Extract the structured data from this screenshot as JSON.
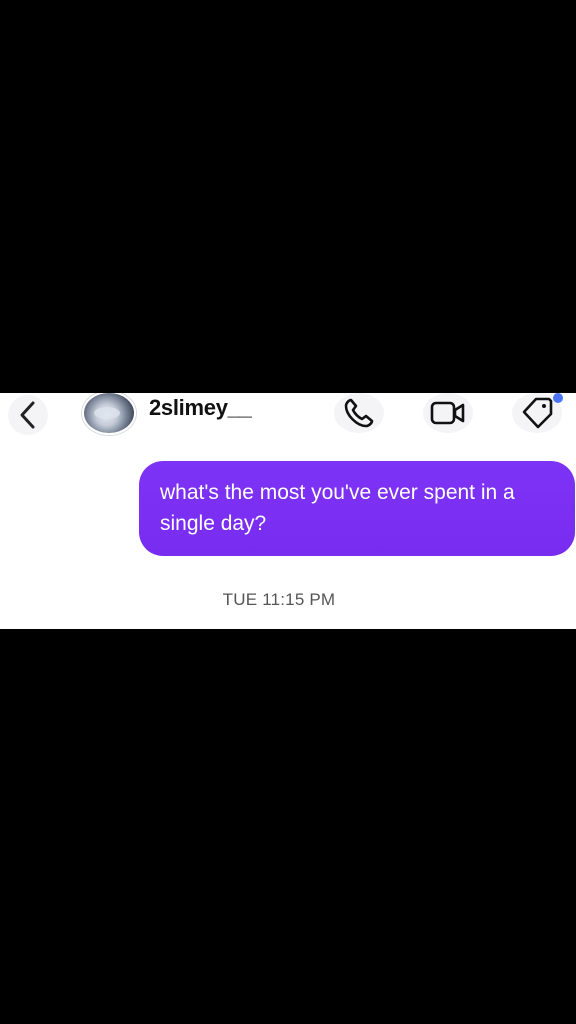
{
  "header": {
    "username": "2slimey__",
    "back_icon": "chevron-left-icon",
    "call_icon": "phone-icon",
    "video_icon": "video-camera-icon",
    "tag_icon": "tag-icon",
    "notification_dot_color": "#4a74f5"
  },
  "thread": {
    "messages": [
      {
        "direction": "outgoing",
        "text": "what's the most you've ever spent in a single day?",
        "bubble_color": "#7b2ff7"
      }
    ],
    "timestamp": "TUE 11:15 PM"
  }
}
